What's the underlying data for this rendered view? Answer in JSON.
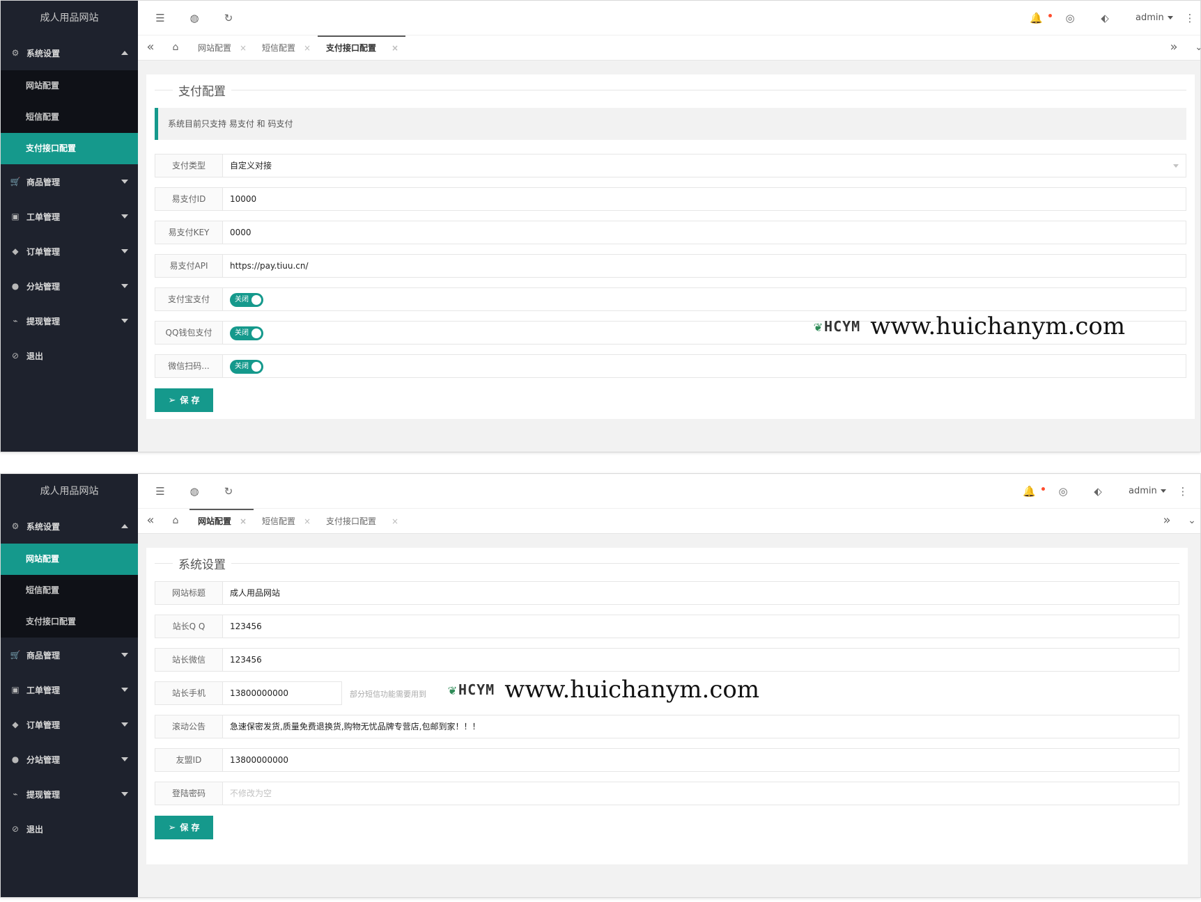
{
  "site_name": "成人用品网站",
  "menu": {
    "system": "系统设置",
    "sub": [
      "网站配置",
      "短信配置",
      "支付接口配置"
    ],
    "groups": [
      "商品管理",
      "工单管理",
      "订单管理",
      "分站管理",
      "提现管理"
    ],
    "logout": "退出"
  },
  "header": {
    "user": "admin"
  },
  "tabs": [
    "网站配置",
    "短信配置",
    "支付接口配置"
  ],
  "tab_close": "×",
  "icons": {
    "menu": "menu-icon",
    "globe": "globe-icon",
    "refresh": "refresh-icon",
    "bell": "bell-icon",
    "theme": "palette-icon",
    "tag": "tag-icon",
    "more": "more-icon",
    "home": "home-icon",
    "prev": "double-left-icon",
    "next": "double-right-icon",
    "down": "chevron-down-icon"
  },
  "colors": {
    "accent": "#15998c",
    "sidebar": "#1e222d",
    "sidebar_sub": "#0f1117"
  },
  "shot1": {
    "section_title": "支付配置",
    "notice": "系统目前只支持 易支付 和 码支付",
    "fields": [
      {
        "label": "支付类型",
        "value": "自定义对接"
      },
      {
        "label": "易支付ID",
        "value": "10000"
      },
      {
        "label": "易支付KEY",
        "value": "0000"
      },
      {
        "label": "易支付API",
        "value": "https://pay.tiuu.cn/"
      }
    ],
    "switches": [
      {
        "label": "支付宝支付",
        "text": "关闭"
      },
      {
        "label": "QQ钱包支付",
        "text": "关闭"
      },
      {
        "label": "微信扫码...",
        "text": "关闭"
      }
    ],
    "save": "保 存"
  },
  "shot2": {
    "section_title": "系统设置",
    "fields": [
      {
        "label": "网站标题",
        "value": "成人用品网站"
      },
      {
        "label": "站长Q Q",
        "value": "123456"
      },
      {
        "label": "站长微信",
        "value": "123456"
      },
      {
        "label": "站长手机",
        "value": "13800000000"
      },
      {
        "label": "滚动公告",
        "value": "急速保密发货,质量免费退换货,购物无忧品牌专营店,包邮到家！！！"
      },
      {
        "label": "友盟ID",
        "value": "13800000000"
      },
      {
        "label": "登陆密码",
        "placeholder": "不修改为空"
      }
    ],
    "phone_hint": "部分短信功能需要用到",
    "save": "保 存"
  },
  "watermark": {
    "logo": "HCYM",
    "url": "www.huichanym.com"
  }
}
